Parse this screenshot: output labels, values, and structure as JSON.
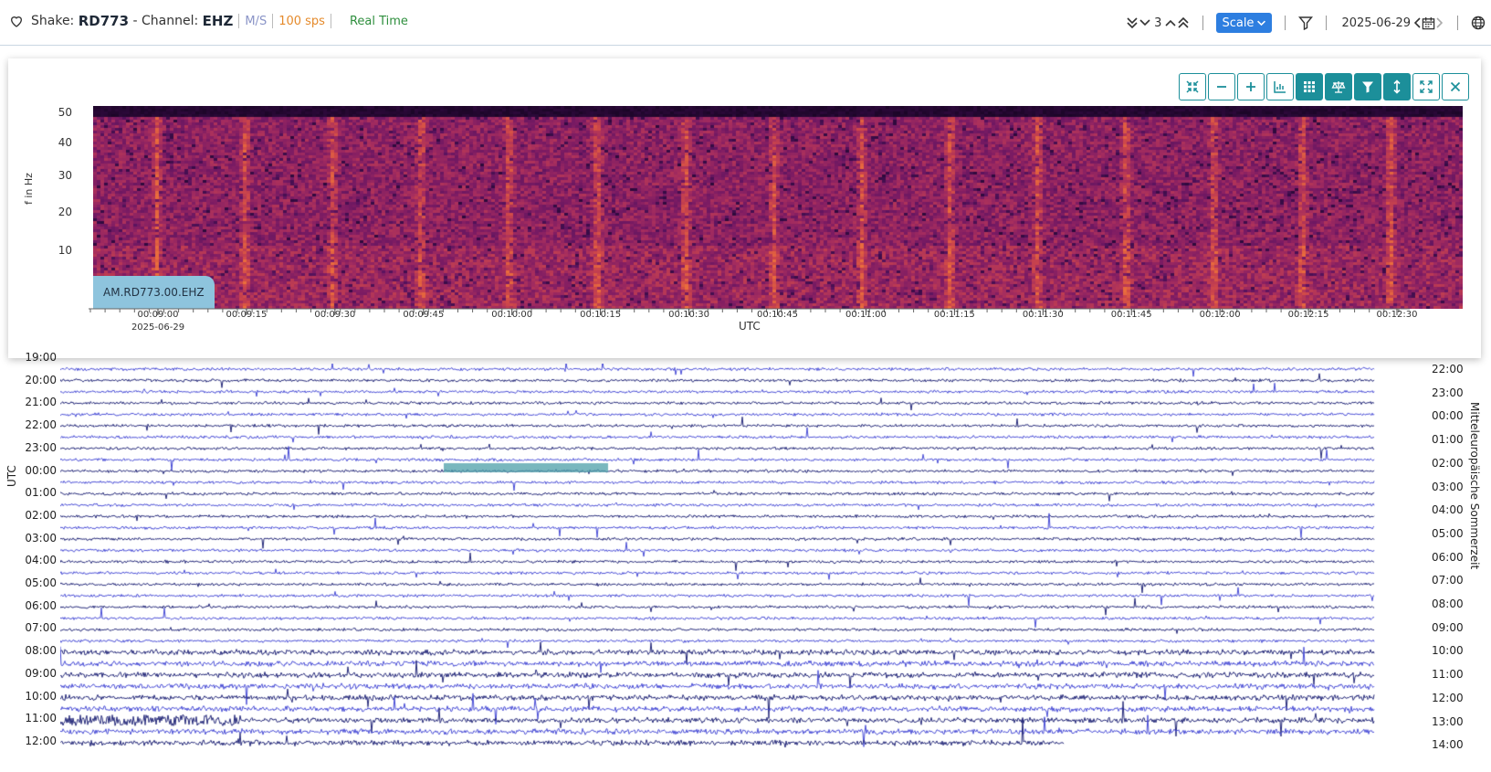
{
  "header": {
    "shake_prefix": "Shake:",
    "station": "RD773",
    "channel_prefix": "- Channel:",
    "channel": "EHZ",
    "units": "M/S",
    "sps": "100 sps",
    "realtime": "Real Time",
    "line_count": "3",
    "scale_label": "Scale",
    "date": "2025-06-29"
  },
  "colors": {
    "accent": "#1c8f9a",
    "scale_button": "#2d7ee0",
    "trace_light": "#4b4fd6",
    "trace_dark": "#262a7a",
    "selection": "#4c9fa8"
  },
  "toolbar": {
    "buttons": [
      {
        "name": "compress-icon",
        "active": false
      },
      {
        "name": "zoom-out-icon",
        "active": false
      },
      {
        "name": "zoom-in-icon",
        "active": false
      },
      {
        "name": "chart-icon",
        "active": false
      },
      {
        "name": "grid-icon",
        "active": true
      },
      {
        "name": "balance-icon",
        "active": true
      },
      {
        "name": "filter-icon",
        "active": true
      },
      {
        "name": "vertical-arrows-icon",
        "active": true
      },
      {
        "name": "expand-icon",
        "active": false
      },
      {
        "name": "close-icon",
        "active": false
      }
    ]
  },
  "spectrogram": {
    "label": "AM.RD773.00.EHZ",
    "y_title": "f in Hz",
    "y_ticks": [
      "50",
      "40",
      "30",
      "20",
      "10"
    ],
    "x_ticks": [
      "00:09:00",
      "00:09:15",
      "00:09:30",
      "00:09:45",
      "00:10:00",
      "00:10:15",
      "00:10:30",
      "00:10:45",
      "00:11:00",
      "00:11:15",
      "00:11:30",
      "00:11:45",
      "00:12:00",
      "00:12:15",
      "00:12:30"
    ],
    "x_first_date": "2025-06-29",
    "x_title": "UTC"
  },
  "helicorder": {
    "left_axis_title": "UTC",
    "right_axis_title": "Mitteleuropäische Sommerzeit",
    "left_labels": [
      "19:00",
      "20:00",
      "21:00",
      "22:00",
      "23:00",
      "00:00",
      "01:00",
      "02:00",
      "03:00",
      "04:00",
      "05:00",
      "06:00",
      "07:00",
      "08:00",
      "09:00",
      "10:00",
      "11:00",
      "12:00"
    ],
    "right_labels": [
      "22:00",
      "23:00",
      "00:00",
      "01:00",
      "02:00",
      "03:00",
      "04:00",
      "05:00",
      "06:00",
      "07:00",
      "08:00",
      "09:00",
      "10:00",
      "11:00",
      "12:00",
      "13:00",
      "14:00"
    ]
  }
}
